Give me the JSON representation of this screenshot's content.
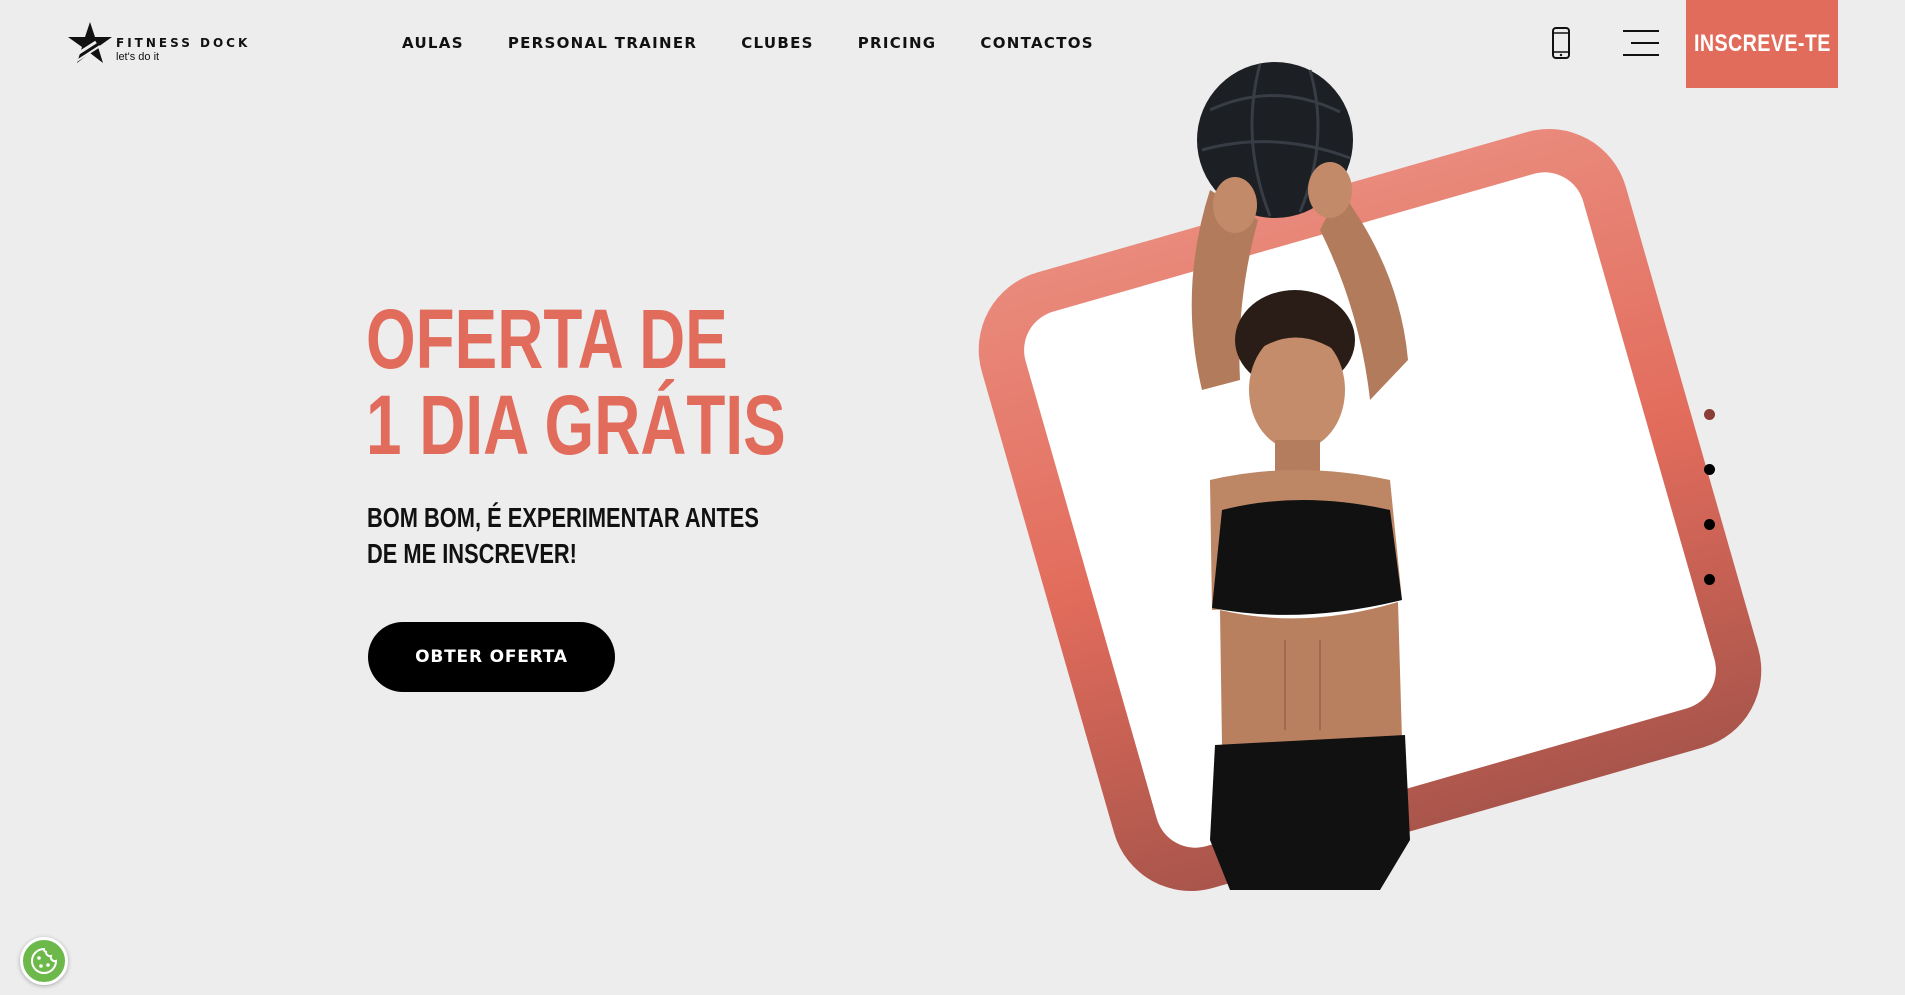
{
  "brand": {
    "name": "FITNESS DOCK",
    "tagline": "let's do it"
  },
  "nav": {
    "items": [
      {
        "label": "AULAS"
      },
      {
        "label": "PERSONAL TRAINER"
      },
      {
        "label": "CLUBES"
      },
      {
        "label": "PRICING"
      },
      {
        "label": "CONTACTOS"
      }
    ]
  },
  "header": {
    "cta_label": "INSCREVE-TE",
    "phone_icon": "phone-icon",
    "menu_icon": "hamburger-menu-icon"
  },
  "hero": {
    "title_line1": "OFERTA DE",
    "title_line2": "1 DIA GRÁTIS",
    "subtitle_line1": "BOM BOM, É EXPERIMENTAR ANTES",
    "subtitle_line2": "DE ME INSCREVER!",
    "button_label": "OBTER OFERTA"
  },
  "slider": {
    "count": 4,
    "active_index": 0
  },
  "colors": {
    "accent": "#e26c5c",
    "background": "#ededed",
    "text": "#111111",
    "button": "#000000",
    "active_dot": "#8a3e37",
    "cookie": "#6db84a"
  }
}
